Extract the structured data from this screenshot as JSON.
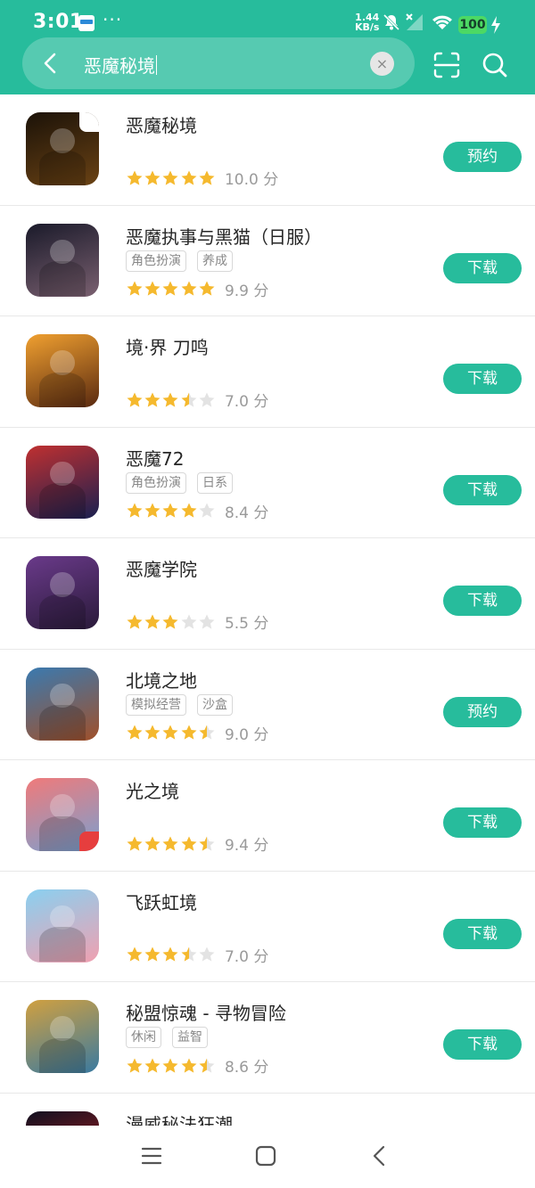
{
  "status_bar": {
    "time": "3:01",
    "net_speed": "1.44",
    "net_unit": "KB/s",
    "battery": "100"
  },
  "search": {
    "query": "恶魔秘境"
  },
  "apps": [
    {
      "name": "恶魔秘境",
      "tags": [],
      "stars": 5,
      "score": "10.0 分",
      "action": "预约",
      "icon_colors": [
        "#1b1208",
        "#6a4214"
      ]
    },
    {
      "name": "恶魔执事与黑猫（日服）",
      "tags": [
        "角色扮演",
        "养成"
      ],
      "stars": 5,
      "score": "9.9 分",
      "action": "下载",
      "icon_colors": [
        "#1a1a2a",
        "#7a6070"
      ]
    },
    {
      "name": "境·界 刀鸣",
      "tags": [],
      "stars": 3.5,
      "score": "7.0 分",
      "action": "下载",
      "icon_colors": [
        "#f0a030",
        "#5a2a10"
      ]
    },
    {
      "name": "恶魔72",
      "tags": [
        "角色扮演",
        "日系"
      ],
      "stars": 4,
      "score": "8.4 分",
      "action": "下载",
      "icon_colors": [
        "#c03030",
        "#1a2050"
      ]
    },
    {
      "name": "恶魔学院",
      "tags": [],
      "stars": 3,
      "score": "5.5 分",
      "action": "下载",
      "icon_colors": [
        "#6a3a8a",
        "#2a1a3a"
      ]
    },
    {
      "name": "北境之地",
      "tags": [
        "模拟经营",
        "沙盒"
      ],
      "stars": 4.5,
      "score": "9.0 分",
      "action": "预约",
      "icon_colors": [
        "#3a7ab0",
        "#a0502a"
      ]
    },
    {
      "name": "光之境",
      "tags": [],
      "stars": 4.5,
      "score": "9.4 分",
      "action": "下载",
      "icon_colors": [
        "#f07a7a",
        "#7aa0d0"
      ]
    },
    {
      "name": "飞跃虹境",
      "tags": [],
      "stars": 3.5,
      "score": "7.0 分",
      "action": "下载",
      "icon_colors": [
        "#8ad0f0",
        "#f0a0b0"
      ]
    },
    {
      "name": "秘盟惊魂 - 寻物冒险",
      "tags": [
        "休闲",
        "益智"
      ],
      "stars": 4.5,
      "score": "8.6 分",
      "action": "下载",
      "icon_colors": [
        "#d0a040",
        "#3a7aa0"
      ]
    },
    {
      "name": "漫威秘法狂潮",
      "tags": [],
      "stars": 0,
      "score": "",
      "action": "",
      "icon_colors": [
        "#101020",
        "#c02020"
      ]
    }
  ],
  "colors": {
    "brand": "#27bc9c",
    "star": "#f5b92e",
    "star_empty": "#e3e3e3"
  }
}
